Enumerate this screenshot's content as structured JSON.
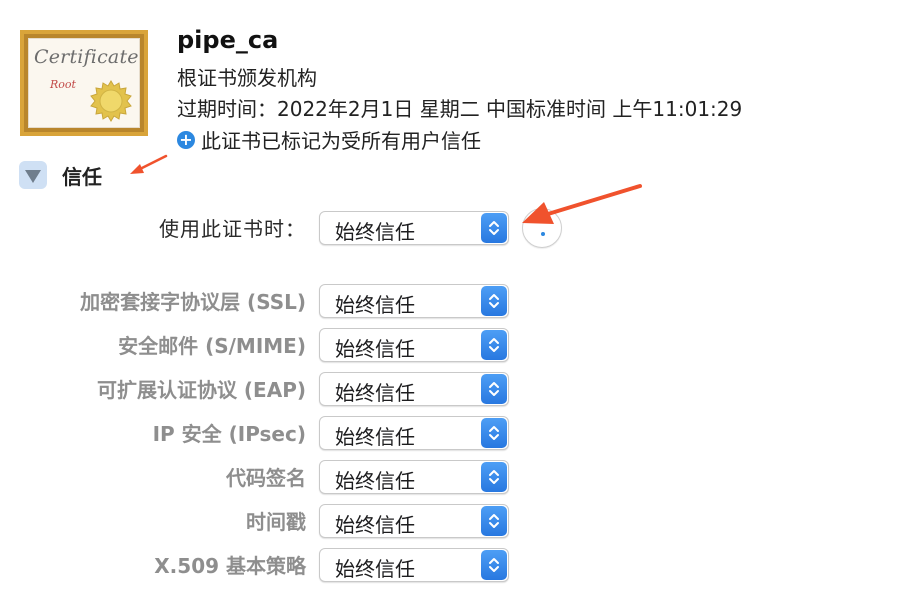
{
  "certificate": {
    "icon_title": "Certificate",
    "icon_subtitle": "Root",
    "name": "pipe_ca",
    "type": "根证书颁发机构",
    "expiry": "过期时间：2022年2月1日 星期二 中国标准时间 上午11:01:29",
    "trust_status": "此证书已标记为受所有用户信任"
  },
  "trust": {
    "section_label": "信任",
    "when_using_label": "使用此证书时：",
    "when_using_value": "始终信任",
    "settings": [
      {
        "label": "加密套接字协议层 (SSL)",
        "value": "始终信任"
      },
      {
        "label": "安全邮件 (S/MIME)",
        "value": "始终信任"
      },
      {
        "label": "可扩展认证协议 (EAP)",
        "value": "始终信任"
      },
      {
        "label": "IP 安全 (IPsec)",
        "value": "始终信任"
      },
      {
        "label": "代码签名",
        "value": "始终信任"
      },
      {
        "label": "时间戳",
        "value": "始终信任"
      },
      {
        "label": "X.509 基本策略",
        "value": "始终信任"
      }
    ]
  },
  "icons": {
    "certificate": "certificate-icon",
    "seal": "seal-icon",
    "plus": "plus-circle-icon",
    "disclosure": "disclosure-triangle-icon",
    "stepper": "chevron-up-down-icon",
    "help": "help-icon",
    "annotation": "annotation-arrow-icon"
  },
  "colors": {
    "accent_blue": "#2c88e0",
    "annotation_red": "#f0522d",
    "frame_gold": "#d9a43a",
    "seal_gold": "#e2c24c"
  }
}
